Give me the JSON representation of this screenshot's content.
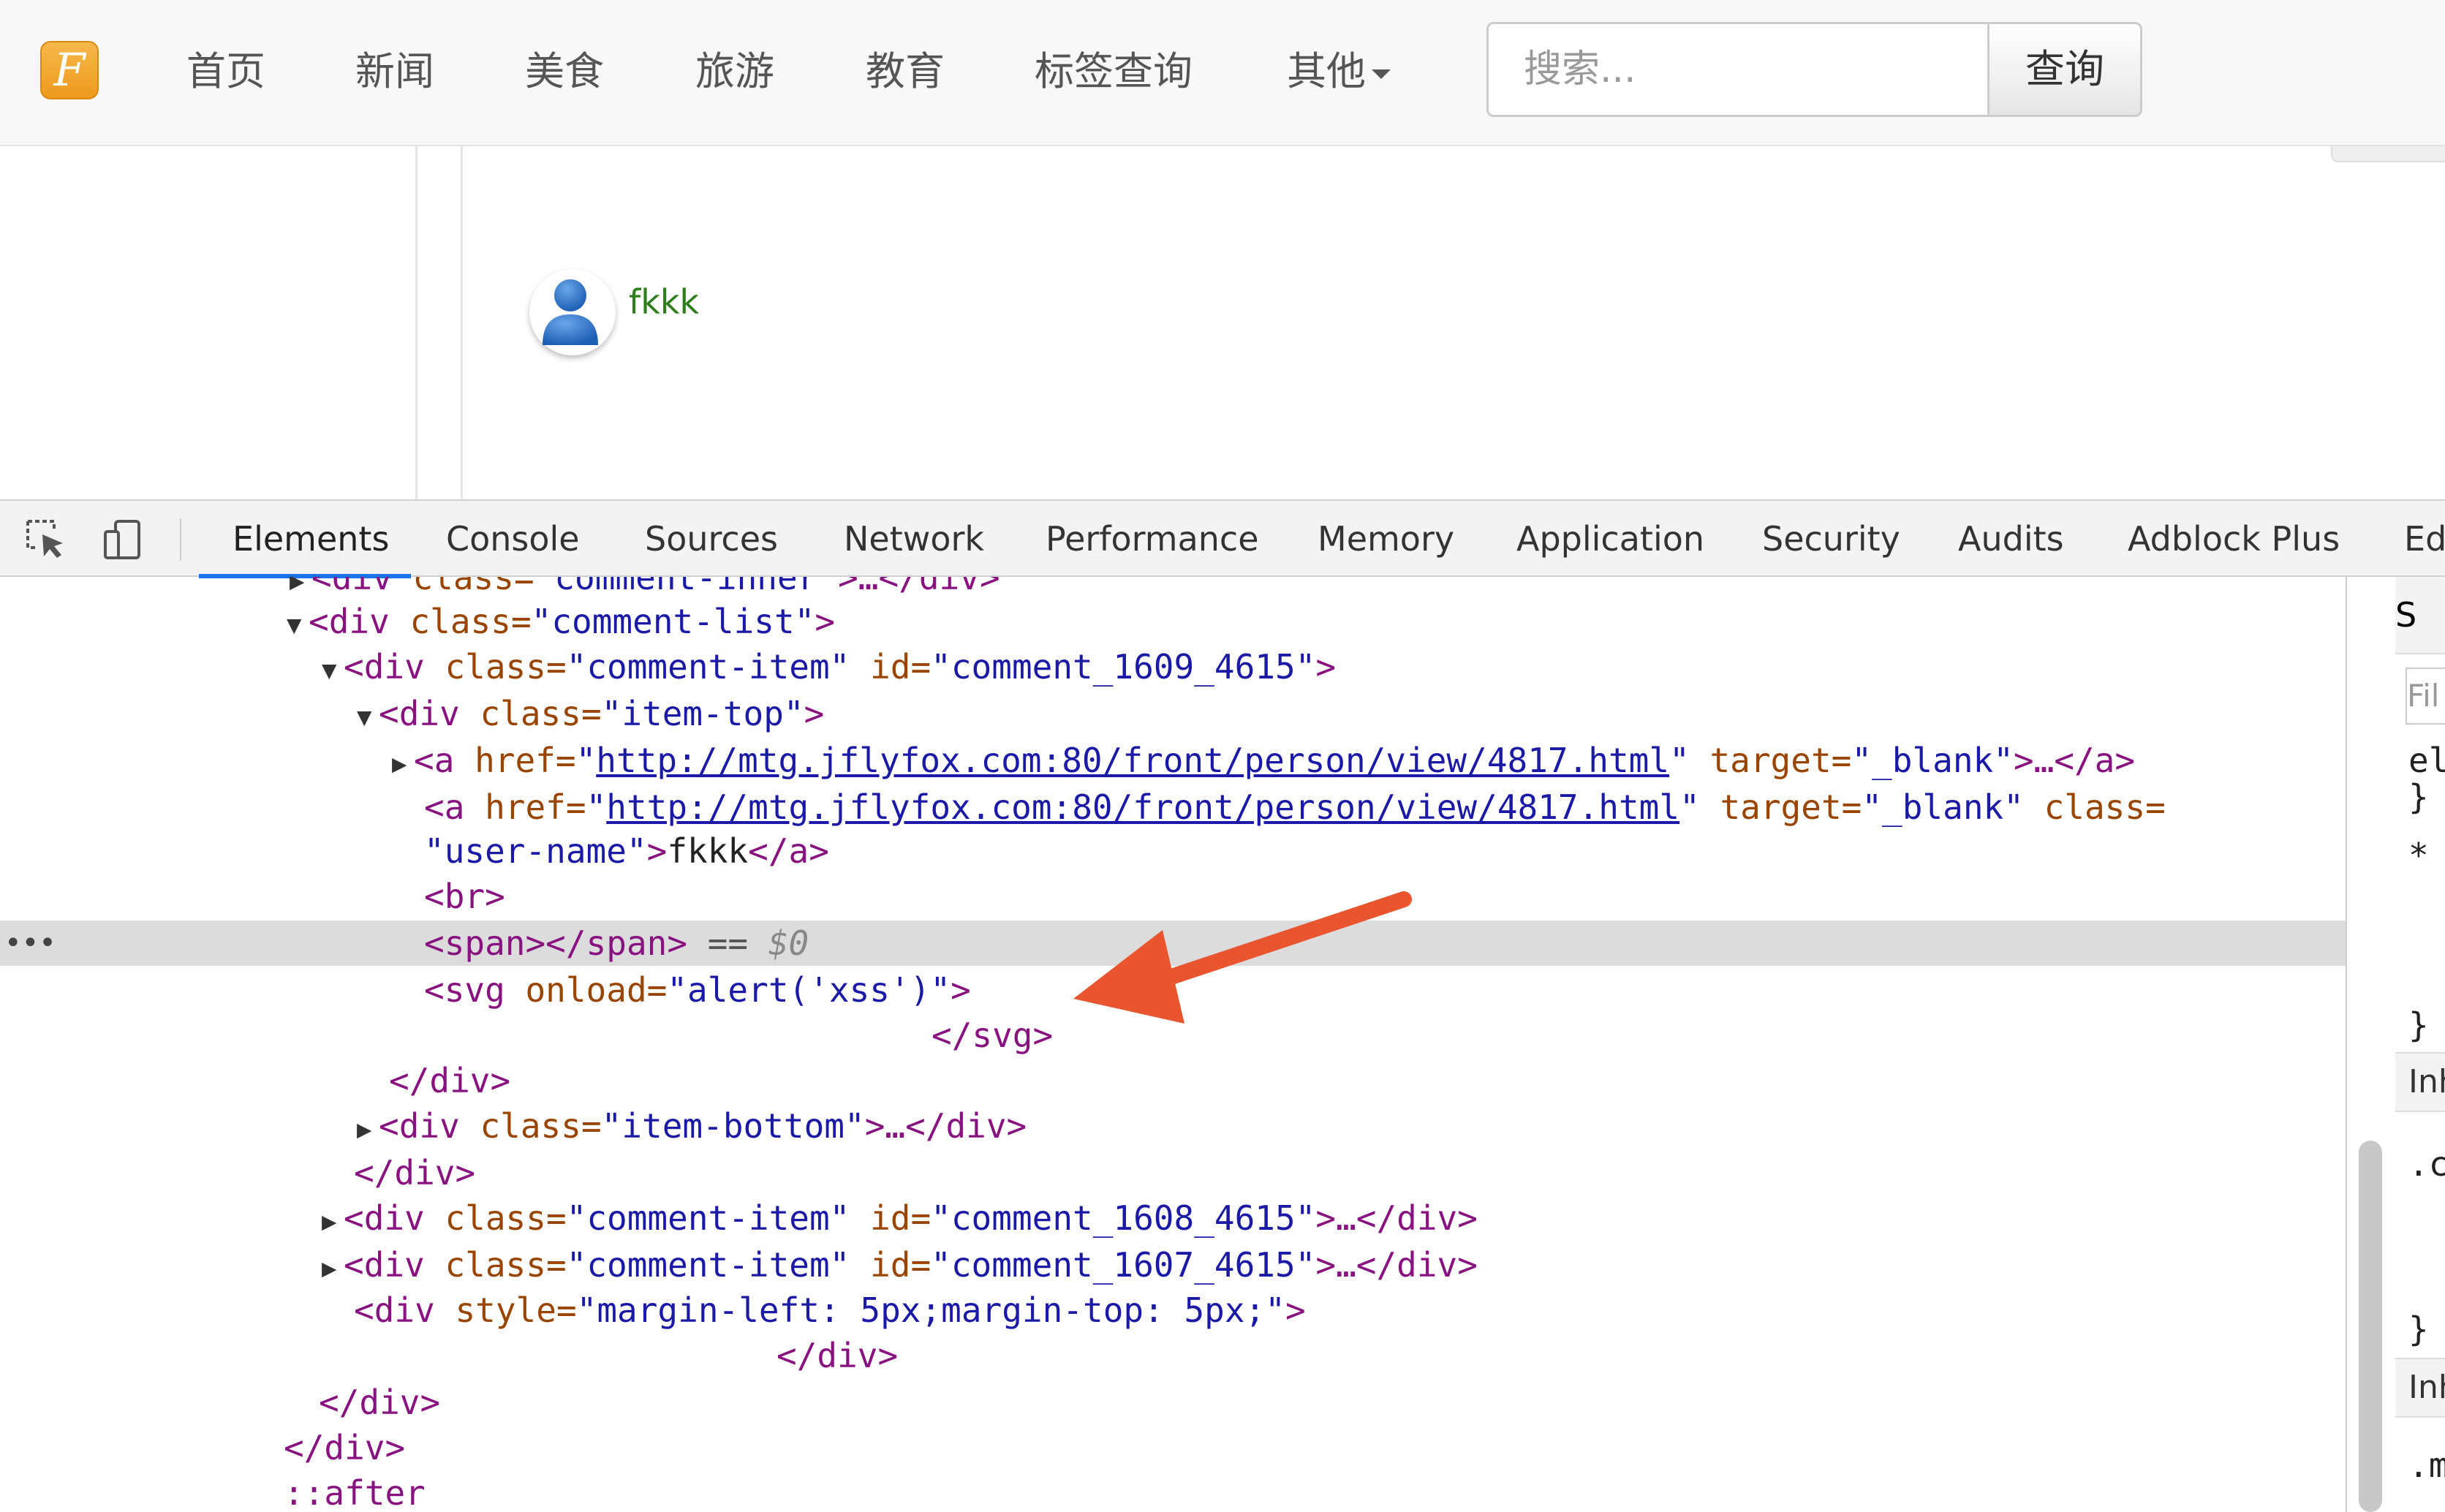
{
  "site_nav": {
    "logo_letter": "F",
    "items": [
      "首页",
      "新闻",
      "美食",
      "旅游",
      "教育",
      "标签查询",
      "其他"
    ],
    "search_placeholder": "搜索...",
    "search_button": "查询"
  },
  "comment": {
    "username": "fkkk"
  },
  "devtools": {
    "tabs": [
      "Elements",
      "Console",
      "Sources",
      "Network",
      "Performance",
      "Memory",
      "Application",
      "Security",
      "Audits",
      "Adblock Plus",
      "Ed"
    ],
    "active_tab": "Elements",
    "dom": {
      "l0": {
        "tag": "<div",
        "attr": " class=",
        "val": "\"comment-inner\"",
        "rest": ">…</div>"
      },
      "l1": {
        "tag": "<div",
        "attr": " class=",
        "val": "\"comment-list\"",
        "end": ">"
      },
      "l2": {
        "tag": "<div",
        "attr1": " class=",
        "val1": "\"comment-item\"",
        "attr2": " id=",
        "val2": "\"comment_1609_4615\"",
        "end": ">"
      },
      "l3": {
        "tag": "<div",
        "attr": " class=",
        "val": "\"item-top\"",
        "end": ">"
      },
      "l4": {
        "tag": "<a",
        "attr1": " href=",
        "q1": "\"",
        "url": "http://mtg.jflyfox.com:80/front/person/view/4817.html",
        "q2": "\"",
        "attr2": " target=",
        "val2": "\"_blank\"",
        "end": ">…</a>"
      },
      "l5": {
        "tag": "<a",
        "attr1": " href=",
        "q1": "\"",
        "url": "http://mtg.jflyfox.com:80/front/person/view/4817.html",
        "q2": "\"",
        "attr2": " target=",
        "val2": "\"_blank\"",
        "attr3": " class="
      },
      "l6": {
        "val": "\"user-name\"",
        "end1": ">",
        "text": "fkkk",
        "end2": "</a>"
      },
      "l7": {
        "tag": "<br>"
      },
      "l8": {
        "tag": "<span></span>",
        "eq": " == ",
        "dollar": "$0"
      },
      "l9": {
        "tag": "<svg",
        "attr": " onload=",
        "val": "\"alert('xss')\"",
        "end": ">"
      },
      "l10": {
        "tag": "</svg>"
      },
      "l11": {
        "tag": "</div>"
      },
      "l12": {
        "tag": "<div",
        "attr": " class=",
        "val": "\"item-bottom\"",
        "rest": ">…</div>"
      },
      "l13": {
        "tag": "</div>"
      },
      "l14": {
        "tag": "<div",
        "attr1": " class=",
        "val1": "\"comment-item\"",
        "attr2": " id=",
        "val2": "\"comment_1608_4615\"",
        "rest": ">…</div>"
      },
      "l15": {
        "tag": "<div",
        "attr1": " class=",
        "val1": "\"comment-item\"",
        "attr2": " id=",
        "val2": "\"comment_1607_4615\"",
        "rest": ">…</div>"
      },
      "l16": {
        "tag": "<div",
        "attr": " style=",
        "val": "\"margin-left: 5px;margin-top: 5px;\"",
        "end": ">"
      },
      "l17": {
        "tag": "</div>"
      },
      "l18": {
        "tag": "</div>"
      },
      "l19": {
        "tag": "</div>"
      },
      "l20": {
        "tag": "::after"
      }
    },
    "styles_pane": {
      "tab": "S",
      "filter": "Fil",
      "texts": [
        "el",
        "}",
        "*",
        "}",
        ".c",
        "}",
        ".m"
      ],
      "inherited": [
        "Inh",
        "Inh"
      ]
    }
  },
  "colors": {
    "accent": "#1a73e8",
    "arrow": "#e8552f",
    "tag": "#881280",
    "attr": "#994500",
    "value": "#1a1aa6"
  }
}
